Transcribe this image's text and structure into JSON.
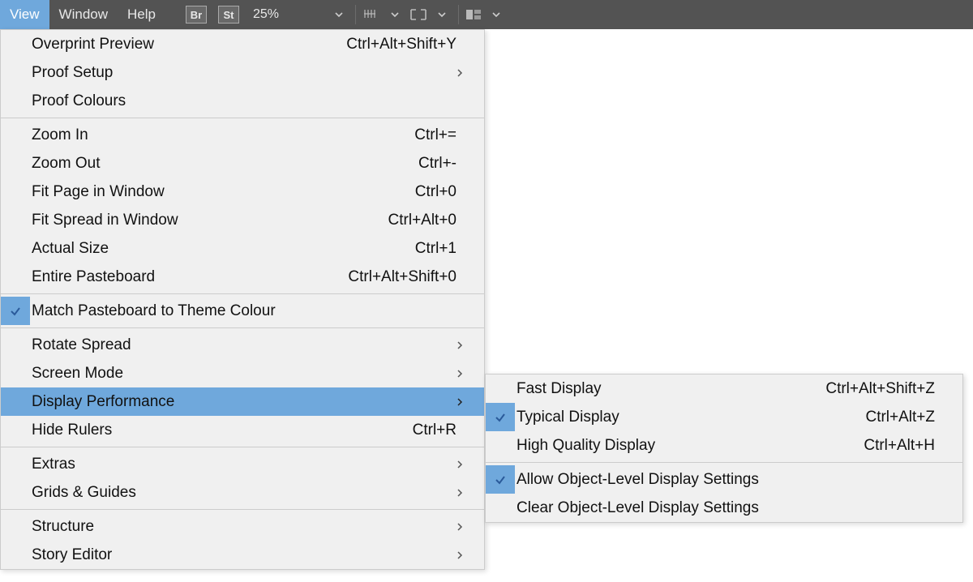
{
  "menubar": {
    "view": "View",
    "window": "Window",
    "help": "Help",
    "br": "Br",
    "st": "St",
    "zoom": "25%"
  },
  "view_menu": {
    "overprint_preview": {
      "label": "Overprint Preview",
      "shortcut": "Ctrl+Alt+Shift+Y"
    },
    "proof_setup": {
      "label": "Proof Setup"
    },
    "proof_colours": {
      "label": "Proof Colours"
    },
    "zoom_in": {
      "label": "Zoom In",
      "shortcut": "Ctrl+="
    },
    "zoom_out": {
      "label": "Zoom Out",
      "shortcut": "Ctrl+-"
    },
    "fit_page": {
      "label": "Fit Page in Window",
      "shortcut": "Ctrl+0"
    },
    "fit_spread": {
      "label": "Fit Spread in Window",
      "shortcut": "Ctrl+Alt+0"
    },
    "actual_size": {
      "label": "Actual Size",
      "shortcut": "Ctrl+1"
    },
    "entire_pasteboard": {
      "label": "Entire Pasteboard",
      "shortcut": "Ctrl+Alt+Shift+0"
    },
    "match_pasteboard": {
      "label": "Match Pasteboard to Theme Colour"
    },
    "rotate_spread": {
      "label": "Rotate Spread"
    },
    "screen_mode": {
      "label": "Screen Mode"
    },
    "display_performance": {
      "label": "Display Performance"
    },
    "hide_rulers": {
      "label": "Hide Rulers",
      "shortcut": "Ctrl+R"
    },
    "extras": {
      "label": "Extras"
    },
    "grids_guides": {
      "label": "Grids & Guides"
    },
    "structure": {
      "label": "Structure"
    },
    "story_editor": {
      "label": "Story Editor"
    }
  },
  "submenu": {
    "fast": {
      "label": "Fast Display",
      "shortcut": "Ctrl+Alt+Shift+Z"
    },
    "typical": {
      "label": "Typical Display",
      "shortcut": "Ctrl+Alt+Z"
    },
    "high": {
      "label": "High Quality Display",
      "shortcut": "Ctrl+Alt+H"
    },
    "allow": {
      "label": "Allow Object-Level Display Settings"
    },
    "clear": {
      "label": "Clear Object-Level Display Settings"
    }
  }
}
